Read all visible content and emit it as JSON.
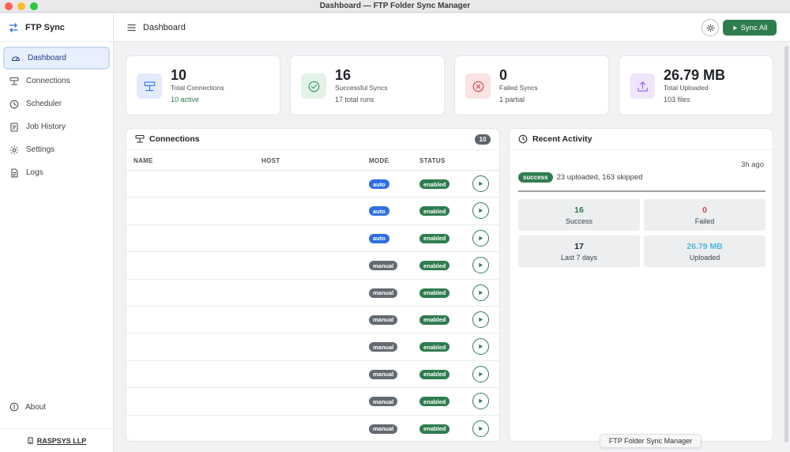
{
  "window": {
    "title": "Dashboard — FTP Folder Sync Manager"
  },
  "sidebar": {
    "brand": "FTP Sync",
    "items": [
      {
        "label": "Dashboard",
        "icon": "gauge-icon",
        "active": true
      },
      {
        "label": "Connections",
        "icon": "connections-icon"
      },
      {
        "label": "Scheduler",
        "icon": "clock-icon"
      },
      {
        "label": "Job History",
        "icon": "history-icon"
      },
      {
        "label": "Settings",
        "icon": "gear-icon"
      },
      {
        "label": "Logs",
        "icon": "document-icon"
      }
    ],
    "about": "About",
    "footer": "RASPSYS LLP"
  },
  "header": {
    "title": "Dashboard",
    "sync_all": "Sync All"
  },
  "stats": [
    {
      "value": "10",
      "label": "Total Connections",
      "sub": "10 active",
      "icon": "connections-icon",
      "color": "#e3ebfb"
    },
    {
      "value": "16",
      "label": "Successful Syncs",
      "sub": "17 total runs",
      "icon": "check-circle-icon",
      "color": "#e4f3e8"
    },
    {
      "value": "0",
      "label": "Failed Syncs",
      "sub": "1 partial",
      "icon": "x-circle-icon",
      "color": "#f9e3e3"
    },
    {
      "value": "26.79 MB",
      "label": "Total Uploaded",
      "sub": "103 files",
      "icon": "upload-icon",
      "color": "#efe6fb"
    }
  ],
  "connections": {
    "title": "Connections",
    "count": "10",
    "columns": {
      "name": "NAME",
      "host": "HOST",
      "mode": "MODE",
      "status": "STATUS"
    },
    "rows": [
      {
        "mode": "auto",
        "status": "enabled"
      },
      {
        "mode": "auto",
        "status": "enabled"
      },
      {
        "mode": "auto",
        "status": "enabled"
      },
      {
        "mode": "manual",
        "status": "enabled"
      },
      {
        "mode": "manual",
        "status": "enabled"
      },
      {
        "mode": "manual",
        "status": "enabled"
      },
      {
        "mode": "manual",
        "status": "enabled"
      },
      {
        "mode": "manual",
        "status": "enabled"
      },
      {
        "mode": "manual",
        "status": "enabled"
      },
      {
        "mode": "manual",
        "status": "enabled"
      }
    ]
  },
  "activity": {
    "title": "Recent Activity",
    "time_ago": "3h ago",
    "badge": "success",
    "summary": "23 uploaded, 163 skipped",
    "progress": 1.0,
    "tiles": [
      {
        "value": "16",
        "label": "Success",
        "color": "#2f7d4f"
      },
      {
        "value": "0",
        "label": "Failed",
        "color": "#d64545"
      },
      {
        "value": "17",
        "label": "Last 7 days",
        "color": "#1f2328"
      },
      {
        "value": "26.79 MB",
        "label": "Uploaded",
        "color": "#4fb6e0"
      }
    ]
  },
  "tooltip": "FTP Folder Sync Manager"
}
